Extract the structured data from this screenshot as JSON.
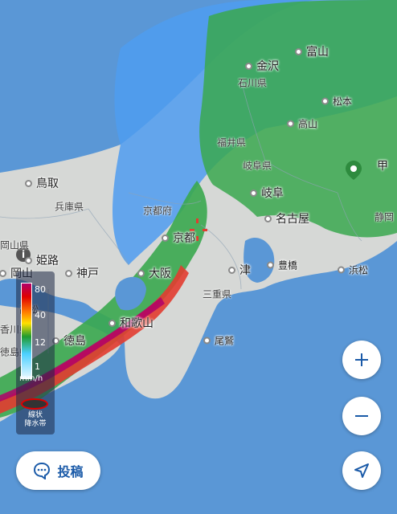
{
  "map": {
    "colors": {
      "sea": "#5a97d6",
      "land": "#d9d9d9",
      "rain_light": "#5fb3ff",
      "rain_mid": "#33a34a",
      "rain_heavy": "#e03030"
    }
  },
  "cities": [
    {
      "name": "富山"
    },
    {
      "name": "金沢"
    },
    {
      "name": "松本"
    },
    {
      "name": "高山"
    },
    {
      "name": "鳥取"
    },
    {
      "name": "岐阜"
    },
    {
      "name": "名古屋"
    },
    {
      "name": "京都"
    },
    {
      "name": "姫路"
    },
    {
      "name": "神戸"
    },
    {
      "name": "大阪"
    },
    {
      "name": "津"
    },
    {
      "name": "豊橋"
    },
    {
      "name": "浜松"
    },
    {
      "name": "岡山"
    },
    {
      "name": "和歌山"
    },
    {
      "name": "徳島"
    },
    {
      "name": "尾鷲"
    },
    {
      "name": "甲"
    }
  ],
  "prefectures": [
    {
      "name": "石川県"
    },
    {
      "name": "福井県"
    },
    {
      "name": "岐阜県"
    },
    {
      "name": "兵庫県"
    },
    {
      "name": "京都府"
    },
    {
      "name": "三重県"
    },
    {
      "name": "静岡"
    },
    {
      "name": "岡山県"
    },
    {
      "name": "香川県"
    },
    {
      "name": "高松"
    },
    {
      "name": "徳島県"
    }
  ],
  "legend": {
    "ticks": [
      "80",
      "40",
      "12",
      "1"
    ],
    "unit": "mm/h",
    "band_label_1": "線状",
    "band_label_2": "降水帯"
  },
  "controls": {
    "post_label": "投稿",
    "zoom_in_icon": "plus-icon",
    "zoom_out_icon": "minus-icon",
    "location_icon": "navigation-arrow-icon",
    "post_icon": "chat-bubble-icon"
  }
}
